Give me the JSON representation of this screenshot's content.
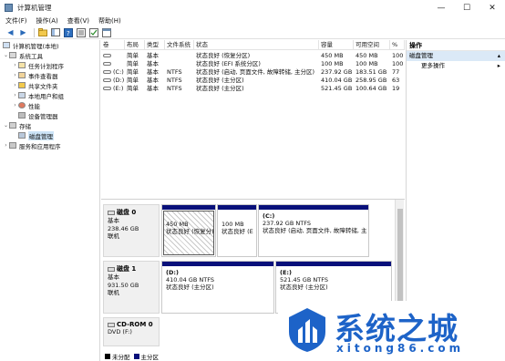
{
  "window": {
    "title": "计算机管理",
    "controls": {
      "minimize": "—",
      "maximize": "☐",
      "close": "✕"
    }
  },
  "menu": [
    "文件(F)",
    "操作(A)",
    "查看(V)",
    "帮助(H)"
  ],
  "tree": {
    "root": "计算机管理(本地)",
    "system_tools": "系统工具",
    "items": [
      "任务计划程序",
      "事件查看器",
      "共享文件夹",
      "本地用户和组",
      "性能",
      "设备管理器"
    ],
    "storage": "存储",
    "disk_management": "磁盘管理",
    "services": "服务和应用程序"
  },
  "volume_list": {
    "columns": [
      "卷",
      "布局",
      "类型",
      "文件系统",
      "状态",
      "容量",
      "可用空间",
      "%"
    ],
    "rows": [
      {
        "vol": "",
        "layout": "简单",
        "type": "基本",
        "fs": "",
        "status": "状态良好 (恢复分区)",
        "capacity": "450 MB",
        "free": "450 MB",
        "pct": "100"
      },
      {
        "vol": "",
        "layout": "简单",
        "type": "基本",
        "fs": "",
        "status": "状态良好 (EFI 系统分区)",
        "capacity": "100 MB",
        "free": "100 MB",
        "pct": "100"
      },
      {
        "vol": "(C:)",
        "layout": "简单",
        "type": "基本",
        "fs": "NTFS",
        "status": "状态良好 (启动, 页面文件, 故障转储, 主分区)",
        "capacity": "237.92 GB",
        "free": "183.51 GB",
        "pct": "77"
      },
      {
        "vol": "(D:)",
        "layout": "简单",
        "type": "基本",
        "fs": "NTFS",
        "status": "状态良好 (主分区)",
        "capacity": "410.04 GB",
        "free": "258.95 GB",
        "pct": "63"
      },
      {
        "vol": "(E:)",
        "layout": "简单",
        "type": "基本",
        "fs": "NTFS",
        "status": "状态良好 (主分区)",
        "capacity": "521.45 GB",
        "free": "100.64 GB",
        "pct": "19"
      }
    ]
  },
  "disks": [
    {
      "name": "磁盘 0",
      "type": "基本",
      "size": "238.46 GB",
      "state": "联机",
      "partitions": [
        {
          "label": "",
          "size": "450 MB",
          "status": "状态良好 (恢复分)"
        },
        {
          "label": "",
          "size": "100 MB",
          "status": "状态良好 (E"
        },
        {
          "label": "(C:)",
          "size": "237.92 GB NTFS",
          "status": "状态良好 (启动, 页面文件, 故障转储, 主"
        }
      ]
    },
    {
      "name": "磁盘 1",
      "type": "基本",
      "size": "931.50 GB",
      "state": "联机",
      "partitions": [
        {
          "label": "(D:)",
          "size": "410.04 GB NTFS",
          "status": "状态良好 (主分区)"
        },
        {
          "label": "(E:)",
          "size": "521.45 GB NTFS",
          "status": "状态良好 (主分区)"
        }
      ]
    },
    {
      "name": "CD-ROM 0",
      "type": "DVD (F:)",
      "size": "",
      "state": ""
    }
  ],
  "legend": [
    {
      "label": "未分配",
      "color": "#000000"
    },
    {
      "label": "主分区",
      "color": "#08107a"
    }
  ],
  "actions": {
    "title": "操作",
    "section": "磁盘管理",
    "more": "更多操作"
  },
  "watermark": {
    "text": "系统之城",
    "url": "xitong86.com"
  }
}
